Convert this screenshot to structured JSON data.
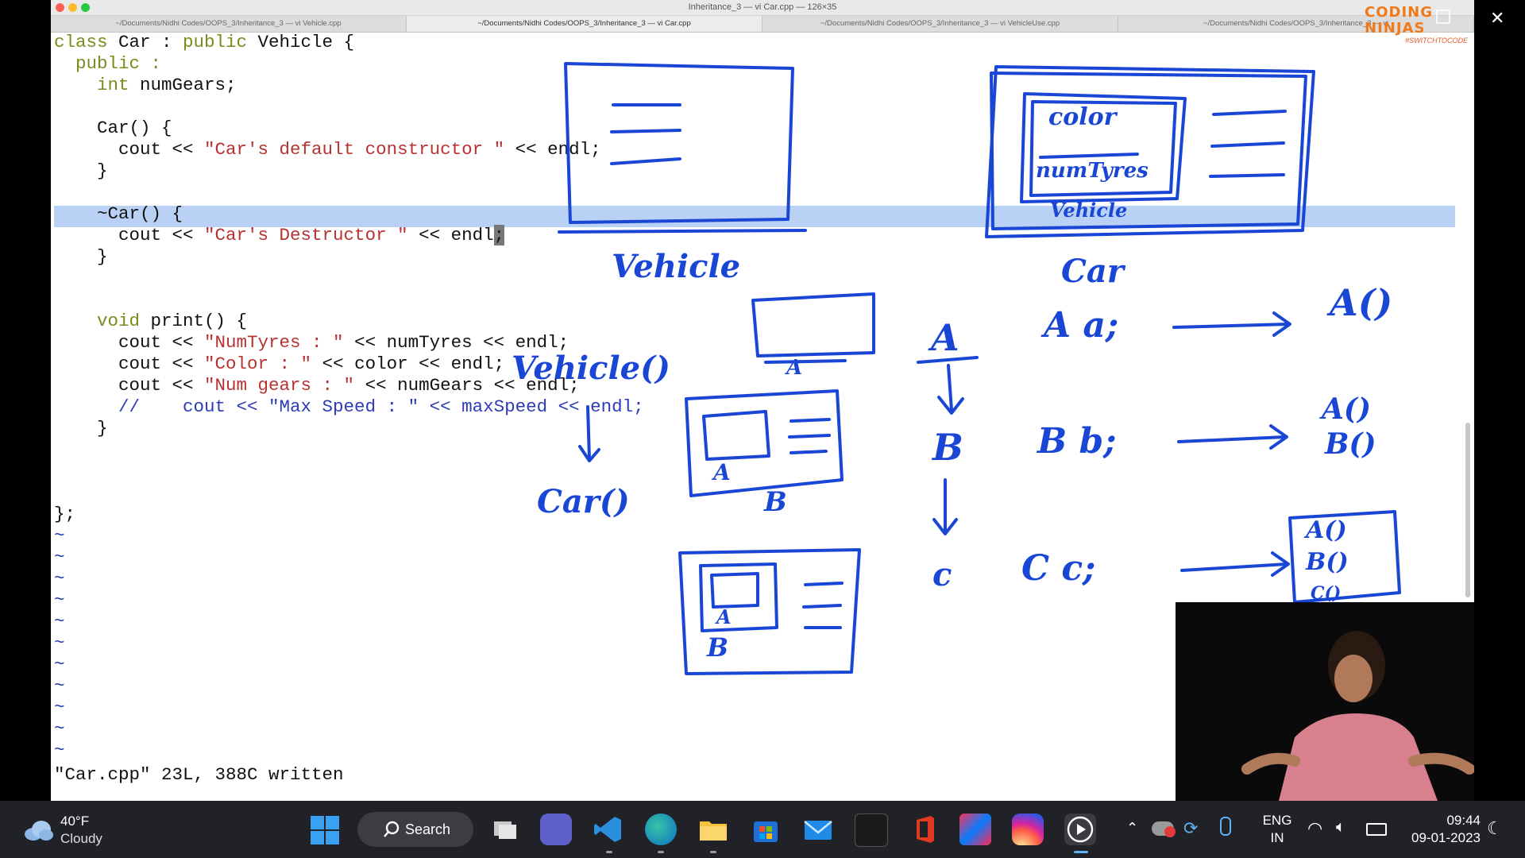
{
  "window": {
    "title": "Inheritance_3 — vi Car.cpp — 126×35",
    "traffic_colors": [
      "#fd5f57",
      "#febb2e",
      "#28c840"
    ]
  },
  "tabs": [
    {
      "label": "~/Documents/Nidhi Codes/OOPS_3/Inheritance_3 — vi Vehicle.cpp"
    },
    {
      "label": "~/Documents/Nidhi Codes/OOPS_3/Inheritance_3 — vi Car.cpp",
      "active": true
    },
    {
      "label": "~/Documents/Nidhi Codes/OOPS_3/Inheritance_3 — vi VehicleUse.cpp"
    },
    {
      "label": "~/Documents/Nidhi Codes/OOPS_3/Inheritance_3 — vi"
    }
  ],
  "logo": {
    "text": "CODING NINJAS",
    "tagline": "#SWITCHTOCODE"
  },
  "code": {
    "l1a": "class",
    "l1b": " Car : ",
    "l1c": "public",
    "l1d": " Vehicle {",
    "l2": "  public :",
    "l3a": "    ",
    "l3b": "int",
    "l3c": " numGears;",
    "l5": "    Car() {",
    "l6a": "      cout << ",
    "l6b": "\"Car's default constructor \"",
    "l6c": " << endl;",
    "l7": "    }",
    "l9": "    ~Car() {",
    "l10a": "      cout << ",
    "l10b": "\"Car's Destructor \"",
    "l10c": " << endl",
    "l10d": ";",
    "l11": "    }",
    "l14a": "    ",
    "l14b": "void",
    "l14c": " print() {",
    "l15a": "      cout << ",
    "l15b": "\"NumTyres : \"",
    "l15c": " << numTyres << endl;",
    "l16a": "      cout << ",
    "l16b": "\"Color : \"",
    "l16c": " << color << endl;",
    "l17a": "      cout << ",
    "l17b": "\"Num gears : \"",
    "l17c": " << numGears << endl;",
    "l18": "      //    cout << \"Max Speed : \" << maxSpeed << endl;",
    "l19": "    }",
    "l22": "};",
    "tilde": "~"
  },
  "status": "\"Car.cpp\" 23L, 388C written",
  "annotations": {
    "vehicle_label": "Vehicle",
    "car_label": "Car",
    "color": "color",
    "numtyres": "numTyres",
    "vehicle_inner": "Vehicle",
    "vehicle_ctor": "Vehicle()",
    "car_ctor": "Car()",
    "box_a1": "A",
    "box_a2": "A",
    "box_b1": "B",
    "box_a3": "A",
    "box_b2": "B",
    "chain_a": "A",
    "chain_b": "B",
    "chain_c": "c",
    "decl_a": "A  a;",
    "decl_b": "B  b;",
    "decl_c": "C  c;",
    "res_a": "A()",
    "res_b1": "A()",
    "res_b2": "B()",
    "res_c1": "A()",
    "res_c2": "B()",
    "res_c3": "C()"
  },
  "taskbar": {
    "weather_temp": "40°F",
    "weather_desc": "Cloudy",
    "search": "Search",
    "lang_top": "ENG",
    "lang_bottom": "IN",
    "time": "09:44",
    "date": "09-01-2023"
  }
}
